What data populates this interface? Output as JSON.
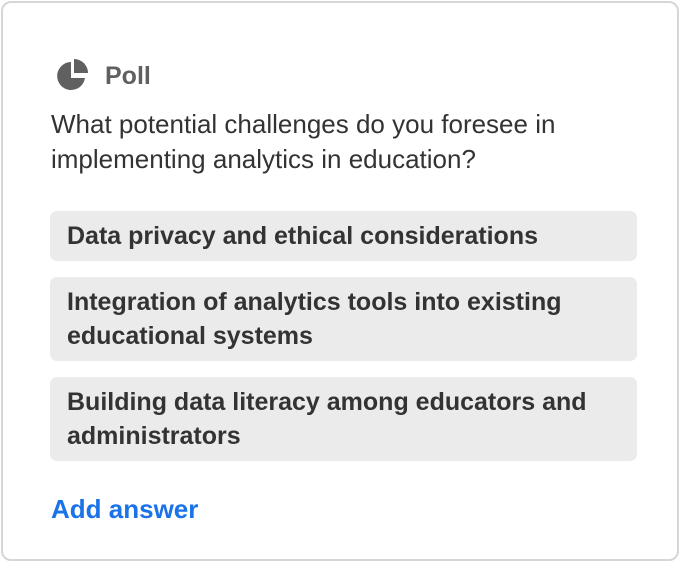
{
  "poll": {
    "icon": "pie-chart-icon",
    "label": "Poll",
    "question": "What potential challenges do you foresee in implementing analytics in education?",
    "options": [
      {
        "label": "Data privacy and ethical considerations"
      },
      {
        "label": "Integration of analytics tools into existing educational systems"
      },
      {
        "label": "Building data literacy among educators and administrators"
      }
    ],
    "add_answer_label": "Add answer"
  },
  "colors": {
    "accent": "#1a73e8",
    "option_bg": "#ebebeb",
    "icon": "#606060",
    "border": "#d6d6d6"
  }
}
